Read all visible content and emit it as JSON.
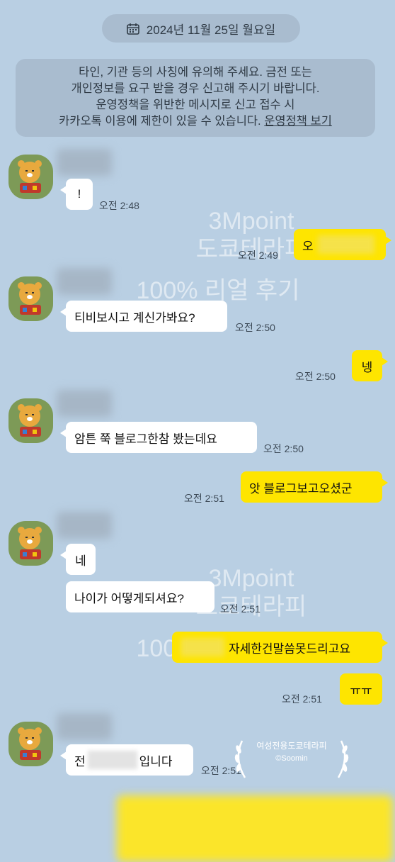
{
  "header": {
    "date": "2024년 11월 25일 월요일"
  },
  "notice": {
    "line1": "타인, 기관 등의 사칭에 유의해 주세요. 금전 또는",
    "line2": "개인정보를 요구 받을 경우 신고해 주시기 바랍니다.",
    "line3": "운영정책을 위반한 메시지로 신고 접수 시",
    "line4_prefix": "카카오톡 이용에 제한이 있을 수 있습니다.",
    "link": "운영정책 보기"
  },
  "watermark": {
    "line1": "3Mpoint",
    "line2": "도쿄테라피",
    "line3": "100% 리얼 후기"
  },
  "badge": {
    "title": "여성전용도쿄테라피",
    "subtitle": "©Soomin"
  },
  "messages": [
    {
      "side": "in",
      "text": "!",
      "time": "오전 2:48"
    },
    {
      "side": "out",
      "text": "오",
      "time": "오전 2:49"
    },
    {
      "side": "in",
      "text": "티비보시고 계신가봐요?",
      "time": "오전 2:50"
    },
    {
      "side": "out",
      "text": "넹",
      "time": "오전 2:50"
    },
    {
      "side": "in",
      "text": "암튼 쭉 블로그한참 봤는데요",
      "time": "오전 2:50"
    },
    {
      "side": "out",
      "text": "앗 블로그보고오셨군",
      "time": "오전 2:51"
    },
    {
      "side": "in",
      "text": "네",
      "time": ""
    },
    {
      "side": "in",
      "text": "나이가 어떻게되셔요?",
      "time": "오전 2:51"
    },
    {
      "side": "out",
      "text": "자세한건말씀못드리고요",
      "time": ""
    },
    {
      "side": "out",
      "text": "ㅠㅠ",
      "time": "오전 2:51"
    },
    {
      "side": "in",
      "text_prefix": "전",
      "text_suffix": "입니다",
      "time": "오전 2:51"
    }
  ],
  "colors": {
    "background": "#b9cfe3",
    "incoming_bubble": "#ffffff",
    "outgoing_bubble": "#fee500",
    "system_pill": "#a9bccf"
  }
}
